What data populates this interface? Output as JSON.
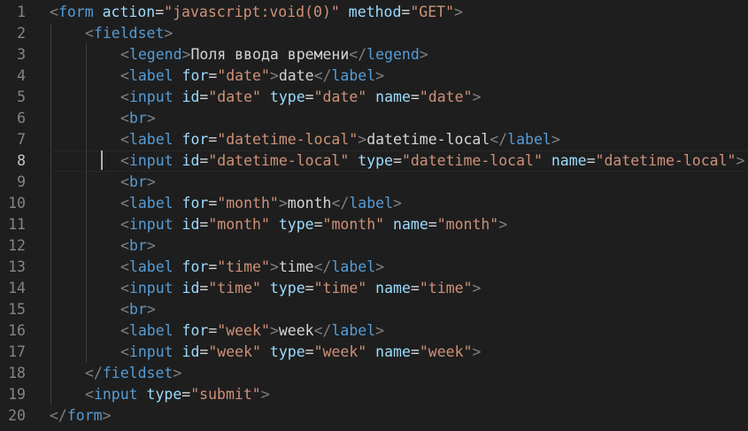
{
  "editor": {
    "current_line": 8,
    "colors": {
      "background": "#1e1e1e",
      "line_number": "#858585",
      "punctuation": "#808080",
      "tag": "#569cd6",
      "attribute": "#9cdcfe",
      "string": "#ce9178",
      "text": "#d4d4d4"
    },
    "lines": [
      {
        "n": "1",
        "indent": 0,
        "tokens": [
          [
            "punct",
            "<"
          ],
          [
            "tag",
            "form"
          ],
          [
            "txt",
            " "
          ],
          [
            "attr",
            "action"
          ],
          [
            "txt",
            "="
          ],
          [
            "str",
            "\"javascript:void(0)\""
          ],
          [
            "txt",
            " "
          ],
          [
            "attr",
            "method"
          ],
          [
            "txt",
            "="
          ],
          [
            "str",
            "\"GET\""
          ],
          [
            "punct",
            ">"
          ]
        ]
      },
      {
        "n": "2",
        "indent": 1,
        "tokens": [
          [
            "punct",
            "<"
          ],
          [
            "tag",
            "fieldset"
          ],
          [
            "punct",
            ">"
          ]
        ]
      },
      {
        "n": "3",
        "indent": 2,
        "tokens": [
          [
            "punct",
            "<"
          ],
          [
            "tag",
            "legend"
          ],
          [
            "punct",
            ">"
          ],
          [
            "txt",
            "Поля ввода времени"
          ],
          [
            "punct",
            "</"
          ],
          [
            "tag",
            "legend"
          ],
          [
            "punct",
            ">"
          ]
        ]
      },
      {
        "n": "4",
        "indent": 2,
        "tokens": [
          [
            "punct",
            "<"
          ],
          [
            "tag",
            "label"
          ],
          [
            "txt",
            " "
          ],
          [
            "attr",
            "for"
          ],
          [
            "txt",
            "="
          ],
          [
            "str",
            "\"date\""
          ],
          [
            "punct",
            ">"
          ],
          [
            "txt",
            "date"
          ],
          [
            "punct",
            "</"
          ],
          [
            "tag",
            "label"
          ],
          [
            "punct",
            ">"
          ]
        ]
      },
      {
        "n": "5",
        "indent": 2,
        "tokens": [
          [
            "punct",
            "<"
          ],
          [
            "tag",
            "input"
          ],
          [
            "txt",
            " "
          ],
          [
            "attr",
            "id"
          ],
          [
            "txt",
            "="
          ],
          [
            "str",
            "\"date\""
          ],
          [
            "txt",
            " "
          ],
          [
            "attr",
            "type"
          ],
          [
            "txt",
            "="
          ],
          [
            "str",
            "\"date\""
          ],
          [
            "txt",
            " "
          ],
          [
            "attr",
            "name"
          ],
          [
            "txt",
            "="
          ],
          [
            "str",
            "\"date\""
          ],
          [
            "punct",
            ">"
          ]
        ]
      },
      {
        "n": "6",
        "indent": 2,
        "tokens": [
          [
            "punct",
            "<"
          ],
          [
            "tag",
            "br"
          ],
          [
            "punct",
            ">"
          ]
        ]
      },
      {
        "n": "7",
        "indent": 2,
        "tokens": [
          [
            "punct",
            "<"
          ],
          [
            "tag",
            "label"
          ],
          [
            "txt",
            " "
          ],
          [
            "attr",
            "for"
          ],
          [
            "txt",
            "="
          ],
          [
            "str",
            "\"datetime-local\""
          ],
          [
            "punct",
            ">"
          ],
          [
            "txt",
            "datetime-local"
          ],
          [
            "punct",
            "</"
          ],
          [
            "tag",
            "label"
          ],
          [
            "punct",
            ">"
          ]
        ]
      },
      {
        "n": "8",
        "indent": 2,
        "tokens": [
          [
            "punct",
            "<"
          ],
          [
            "tag",
            "input"
          ],
          [
            "txt",
            " "
          ],
          [
            "attr",
            "id"
          ],
          [
            "txt",
            "="
          ],
          [
            "str",
            "\"datetime-local\""
          ],
          [
            "txt",
            " "
          ],
          [
            "attr",
            "type"
          ],
          [
            "txt",
            "="
          ],
          [
            "str",
            "\"datetime-local\""
          ],
          [
            "txt",
            " "
          ],
          [
            "attr",
            "name"
          ],
          [
            "txt",
            "="
          ],
          [
            "str",
            "\"datetime-local\""
          ],
          [
            "punct",
            ">"
          ]
        ]
      },
      {
        "n": "9",
        "indent": 2,
        "tokens": [
          [
            "punct",
            "<"
          ],
          [
            "tag",
            "br"
          ],
          [
            "punct",
            ">"
          ]
        ]
      },
      {
        "n": "10",
        "indent": 2,
        "tokens": [
          [
            "punct",
            "<"
          ],
          [
            "tag",
            "label"
          ],
          [
            "txt",
            " "
          ],
          [
            "attr",
            "for"
          ],
          [
            "txt",
            "="
          ],
          [
            "str",
            "\"month\""
          ],
          [
            "punct",
            ">"
          ],
          [
            "txt",
            "month"
          ],
          [
            "punct",
            "</"
          ],
          [
            "tag",
            "label"
          ],
          [
            "punct",
            ">"
          ]
        ]
      },
      {
        "n": "11",
        "indent": 2,
        "tokens": [
          [
            "punct",
            "<"
          ],
          [
            "tag",
            "input"
          ],
          [
            "txt",
            " "
          ],
          [
            "attr",
            "id"
          ],
          [
            "txt",
            "="
          ],
          [
            "str",
            "\"month\""
          ],
          [
            "txt",
            " "
          ],
          [
            "attr",
            "type"
          ],
          [
            "txt",
            "="
          ],
          [
            "str",
            "\"month\""
          ],
          [
            "txt",
            " "
          ],
          [
            "attr",
            "name"
          ],
          [
            "txt",
            "="
          ],
          [
            "str",
            "\"month\""
          ],
          [
            "punct",
            ">"
          ]
        ]
      },
      {
        "n": "12",
        "indent": 2,
        "tokens": [
          [
            "punct",
            "<"
          ],
          [
            "tag",
            "br"
          ],
          [
            "punct",
            ">"
          ]
        ]
      },
      {
        "n": "13",
        "indent": 2,
        "tokens": [
          [
            "punct",
            "<"
          ],
          [
            "tag",
            "label"
          ],
          [
            "txt",
            " "
          ],
          [
            "attr",
            "for"
          ],
          [
            "txt",
            "="
          ],
          [
            "str",
            "\"time\""
          ],
          [
            "punct",
            ">"
          ],
          [
            "txt",
            "time"
          ],
          [
            "punct",
            "</"
          ],
          [
            "tag",
            "label"
          ],
          [
            "punct",
            ">"
          ]
        ]
      },
      {
        "n": "14",
        "indent": 2,
        "tokens": [
          [
            "punct",
            "<"
          ],
          [
            "tag",
            "input"
          ],
          [
            "txt",
            " "
          ],
          [
            "attr",
            "id"
          ],
          [
            "txt",
            "="
          ],
          [
            "str",
            "\"time\""
          ],
          [
            "txt",
            " "
          ],
          [
            "attr",
            "type"
          ],
          [
            "txt",
            "="
          ],
          [
            "str",
            "\"time\""
          ],
          [
            "txt",
            " "
          ],
          [
            "attr",
            "name"
          ],
          [
            "txt",
            "="
          ],
          [
            "str",
            "\"time\""
          ],
          [
            "punct",
            ">"
          ]
        ]
      },
      {
        "n": "15",
        "indent": 2,
        "tokens": [
          [
            "punct",
            "<"
          ],
          [
            "tag",
            "br"
          ],
          [
            "punct",
            ">"
          ]
        ]
      },
      {
        "n": "16",
        "indent": 2,
        "tokens": [
          [
            "punct",
            "<"
          ],
          [
            "tag",
            "label"
          ],
          [
            "txt",
            " "
          ],
          [
            "attr",
            "for"
          ],
          [
            "txt",
            "="
          ],
          [
            "str",
            "\"week\""
          ],
          [
            "punct",
            ">"
          ],
          [
            "txt",
            "week"
          ],
          [
            "punct",
            "</"
          ],
          [
            "tag",
            "label"
          ],
          [
            "punct",
            ">"
          ]
        ]
      },
      {
        "n": "17",
        "indent": 2,
        "tokens": [
          [
            "punct",
            "<"
          ],
          [
            "tag",
            "input"
          ],
          [
            "txt",
            " "
          ],
          [
            "attr",
            "id"
          ],
          [
            "txt",
            "="
          ],
          [
            "str",
            "\"week\""
          ],
          [
            "txt",
            " "
          ],
          [
            "attr",
            "type"
          ],
          [
            "txt",
            "="
          ],
          [
            "str",
            "\"week\""
          ],
          [
            "txt",
            " "
          ],
          [
            "attr",
            "name"
          ],
          [
            "txt",
            "="
          ],
          [
            "str",
            "\"week\""
          ],
          [
            "punct",
            ">"
          ]
        ]
      },
      {
        "n": "18",
        "indent": 1,
        "tokens": [
          [
            "punct",
            "</"
          ],
          [
            "tag",
            "fieldset"
          ],
          [
            "punct",
            ">"
          ]
        ]
      },
      {
        "n": "19",
        "indent": 1,
        "tokens": [
          [
            "punct",
            "<"
          ],
          [
            "tag",
            "input"
          ],
          [
            "txt",
            " "
          ],
          [
            "attr",
            "type"
          ],
          [
            "txt",
            "="
          ],
          [
            "str",
            "\"submit\""
          ],
          [
            "punct",
            ">"
          ]
        ]
      },
      {
        "n": "20",
        "indent": 0,
        "tokens": [
          [
            "punct",
            "</"
          ],
          [
            "tag",
            "form"
          ],
          [
            "punct",
            ">"
          ]
        ]
      }
    ]
  }
}
